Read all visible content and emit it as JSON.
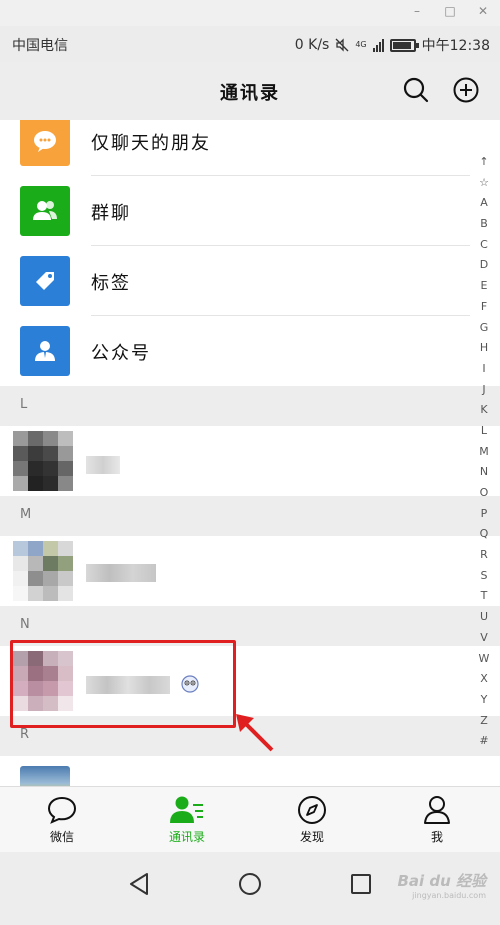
{
  "status": {
    "carrier": "中国电信",
    "speed": "0 K/s",
    "network": "4G",
    "time": "中午12:38"
  },
  "header": {
    "title": "通讯录"
  },
  "features": [
    {
      "label": "仅聊天的朋友",
      "color": "#f7a23a",
      "icon": "chat-bubble-icon"
    },
    {
      "label": "群聊",
      "color": "#1aad19",
      "icon": "group-icon"
    },
    {
      "label": "标签",
      "color": "#2b7fd6",
      "icon": "tag-icon"
    },
    {
      "label": "公众号",
      "color": "#2b7fd6",
      "icon": "official-account-icon"
    }
  ],
  "sections": [
    {
      "letter": "L"
    },
    {
      "letter": "M"
    },
    {
      "letter": "N"
    },
    {
      "letter": "R"
    }
  ],
  "alphabet": [
    "↑",
    "☆",
    "A",
    "B",
    "C",
    "D",
    "E",
    "F",
    "G",
    "H",
    "I",
    "J",
    "K",
    "L",
    "M",
    "N",
    "O",
    "P",
    "Q",
    "R",
    "S",
    "T",
    "U",
    "V",
    "W",
    "X",
    "Y",
    "Z",
    "#"
  ],
  "tabs": [
    {
      "label": "微信",
      "icon": "chat-icon",
      "active": false
    },
    {
      "label": "通讯录",
      "icon": "contacts-icon",
      "active": true
    },
    {
      "label": "发现",
      "icon": "compass-icon",
      "active": false
    },
    {
      "label": "我",
      "icon": "person-icon",
      "active": false
    }
  ],
  "colors": {
    "active": "#1aad19",
    "annotation": "#e02020"
  },
  "watermark": {
    "brand": "Bai du 经验",
    "url": "jingyan.baidu.com"
  }
}
